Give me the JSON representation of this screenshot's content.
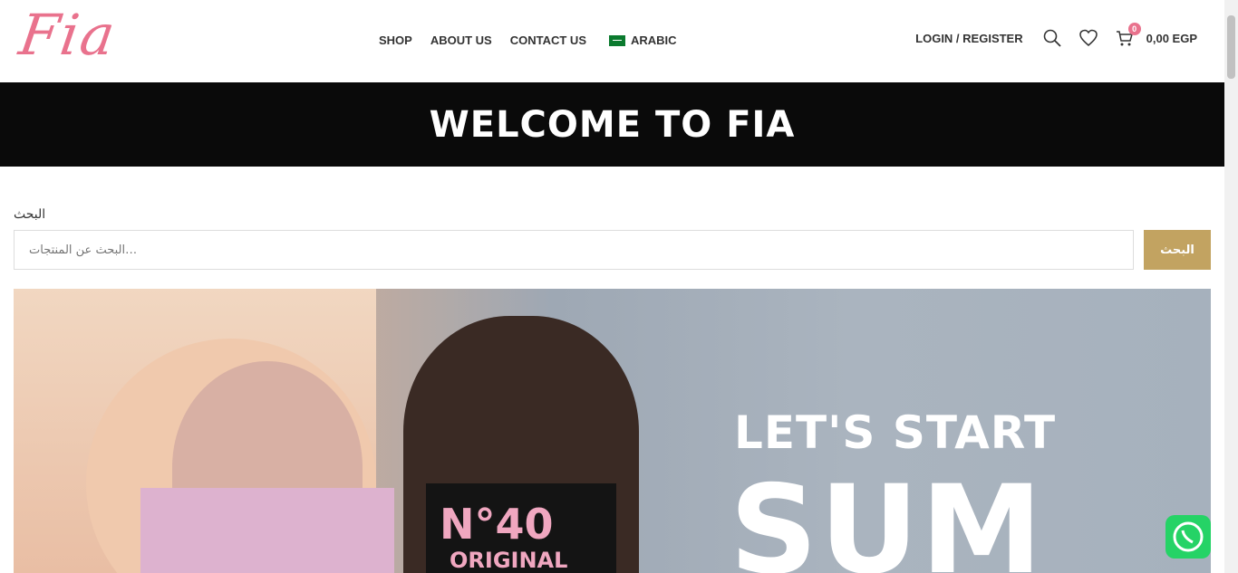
{
  "header": {
    "logo_text": "Fia",
    "nav": [
      "SHOP",
      "ABOUT US",
      "CONTACT US",
      "ARABIC"
    ],
    "login": "LOGIN / REGISTER",
    "cart_count": "0",
    "cart_total": "0,00 EGP"
  },
  "banner": {
    "title": "WELCOME TO FIA"
  },
  "search": {
    "label": "البحث",
    "placeholder": "البحث عن المنتجات…",
    "button": "البحث"
  },
  "hero": {
    "line1": "LET'S START",
    "line2": "SUM",
    "print1": "N°40",
    "print2": "ORIGINAL"
  }
}
